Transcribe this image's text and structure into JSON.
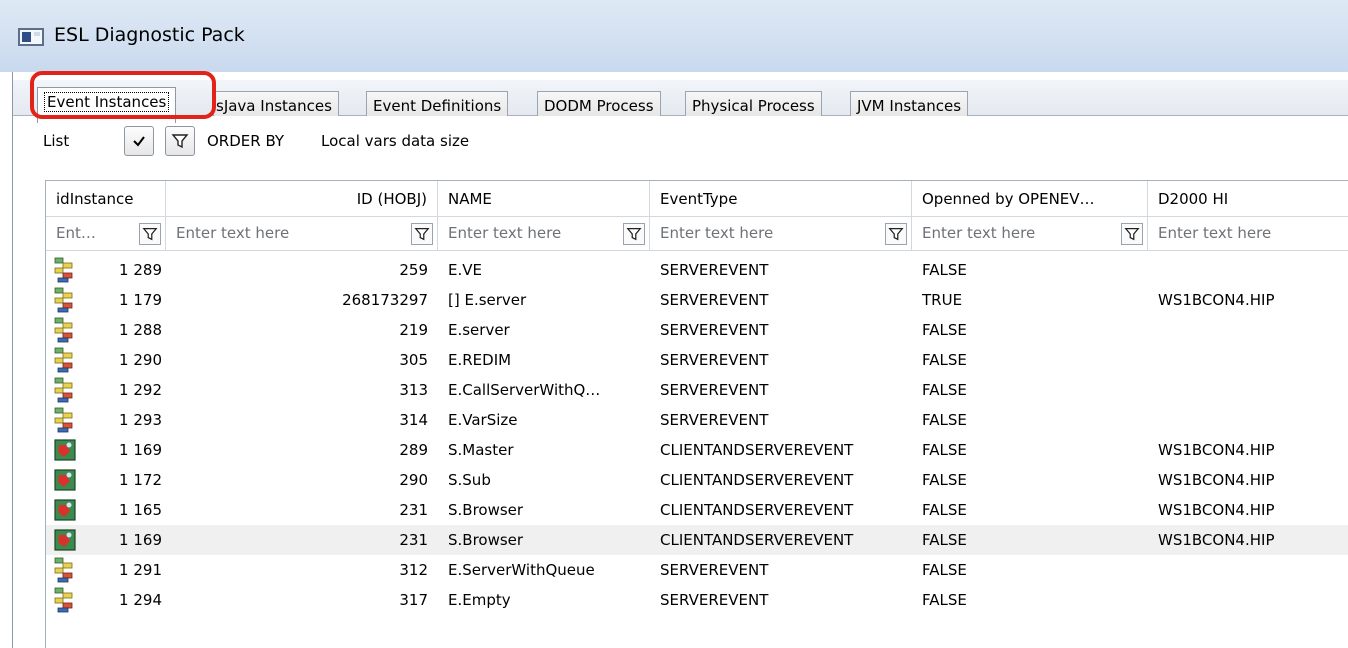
{
  "window": {
    "title": "ESL Diagnostic Pack"
  },
  "tabs": [
    {
      "label": "Event Instances",
      "active": true
    },
    {
      "label": "sJava Instances",
      "active": false
    },
    {
      "label": "Event Definitions",
      "active": false
    },
    {
      "label": "DODM Process",
      "active": false
    },
    {
      "label": "Physical Process",
      "active": false
    },
    {
      "label": "JVM Instances",
      "active": false
    }
  ],
  "toolbar": {
    "list_label": "List",
    "order_by_label": "ORDER BY",
    "order_by_value": "Local vars data size",
    "check_icon": "check-icon",
    "filter_icon": "filter-icon"
  },
  "grid": {
    "columns": [
      "idInstance",
      "ID (HOBJ)",
      "NAME",
      "EventType",
      "Openned by OPENEV…",
      "D2000 HI"
    ],
    "filter_placeholders": [
      "Ent…",
      "Enter text here",
      "Enter text here",
      "Enter text here",
      "Enter text here",
      "Enter text here"
    ],
    "rows": [
      {
        "icon": "server-event-icon",
        "idInstance": "1 289",
        "hobj": "259",
        "name": "E.VE",
        "type": "SERVEREVENT",
        "opened": "FALSE",
        "hi": ""
      },
      {
        "icon": "server-event-icon",
        "idInstance": "1 179",
        "hobj": "268173297",
        "name": "[] E.server",
        "type": "SERVEREVENT",
        "opened": "TRUE",
        "hi": "WS1BCON4.HIP"
      },
      {
        "icon": "server-event-icon",
        "idInstance": "1 288",
        "hobj": "219",
        "name": "E.server",
        "type": "SERVEREVENT",
        "opened": "FALSE",
        "hi": ""
      },
      {
        "icon": "server-event-icon",
        "idInstance": "1 290",
        "hobj": "305",
        "name": "E.REDIM",
        "type": "SERVEREVENT",
        "opened": "FALSE",
        "hi": ""
      },
      {
        "icon": "server-event-icon",
        "idInstance": "1 292",
        "hobj": "313",
        "name": "E.CallServerWithQ…",
        "type": "SERVEREVENT",
        "opened": "FALSE",
        "hi": ""
      },
      {
        "icon": "server-event-icon",
        "idInstance": "1 293",
        "hobj": "314",
        "name": "E.VarSize",
        "type": "SERVEREVENT",
        "opened": "FALSE",
        "hi": ""
      },
      {
        "icon": "client-server-event-icon",
        "idInstance": "1 169",
        "hobj": "289",
        "name": "S.Master",
        "type": "CLIENTANDSERVEREVENT",
        "opened": "FALSE",
        "hi": "WS1BCON4.HIP"
      },
      {
        "icon": "client-server-event-icon",
        "idInstance": "1 172",
        "hobj": "290",
        "name": "S.Sub",
        "type": "CLIENTANDSERVEREVENT",
        "opened": "FALSE",
        "hi": "WS1BCON4.HIP"
      },
      {
        "icon": "client-server-event-icon",
        "idInstance": "1 165",
        "hobj": "231",
        "name": "S.Browser",
        "type": "CLIENTANDSERVEREVENT",
        "opened": "FALSE",
        "hi": "WS1BCON4.HIP"
      },
      {
        "icon": "client-server-event-icon",
        "idInstance": "1 169",
        "hobj": "231",
        "name": "S.Browser",
        "type": "CLIENTANDSERVEREVENT",
        "opened": "FALSE",
        "hi": "WS1BCON4.HIP",
        "selected": true
      },
      {
        "icon": "server-event-icon",
        "idInstance": "1 291",
        "hobj": "312",
        "name": "E.ServerWithQueue",
        "type": "SERVEREVENT",
        "opened": "FALSE",
        "hi": ""
      },
      {
        "icon": "server-event-icon",
        "idInstance": "1 294",
        "hobj": "317",
        "name": "E.Empty",
        "type": "SERVEREVENT",
        "opened": "FALSE",
        "hi": ""
      }
    ]
  }
}
